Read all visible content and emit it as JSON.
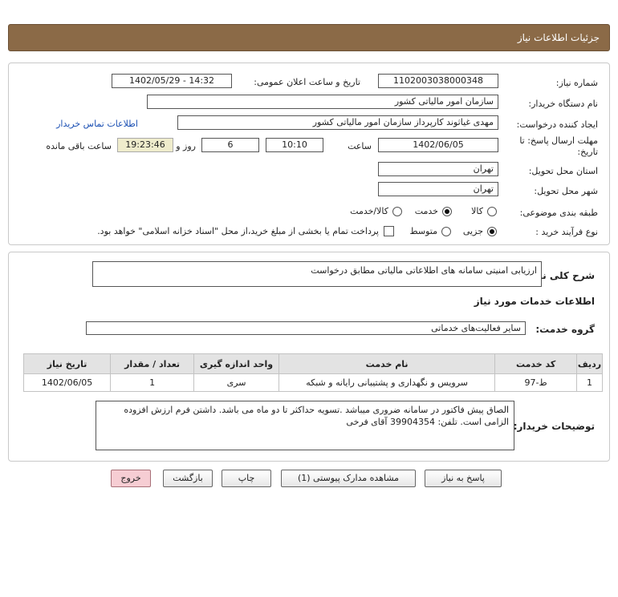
{
  "header": {
    "title": "جزئیات اطلاعات نیاز"
  },
  "form": {
    "need_number_label": "شماره نیاز:",
    "need_number": "1102003038000348",
    "announce_label": "تاریخ و ساعت اعلان عمومی:",
    "announce_value": "1402/05/29 - 14:32",
    "buyer_org_label": "نام دستگاه خریدار:",
    "buyer_org": "سازمان امور مالیاتی کشور",
    "creator_label": "ایجاد کننده درخواست:",
    "creator": "مهدی غیاثوند کارپرداز سازمان امور مالیاتی کشور",
    "contact_link": "اطلاعات تماس خریدار",
    "deadline_label_1": "مهلت ارسال پاسخ: تا",
    "deadline_label_2": "تاریخ:",
    "deadline_date": "1402/06/05",
    "time_label": "ساعت",
    "deadline_time": "10:10",
    "days_value": "6",
    "days_label": "روز و",
    "remaining_time": "19:23:46",
    "remaining_label": "ساعت باقی مانده",
    "province_label": "استان محل تحویل:",
    "province": "تهران",
    "city_label": "شهر محل تحویل:",
    "city": "تهران",
    "category_label": "طبقه بندی موضوعی:",
    "category_options": [
      "کالا",
      "خدمت",
      "کالا/خدمت"
    ],
    "category_selected": "خدمت",
    "purchase_type_label": "نوع فرآیند خرید :",
    "purchase_options": [
      "جزیی",
      "متوسط"
    ],
    "purchase_selected": "جزیی",
    "payment_note": "پرداخت تمام یا بخشی از مبلغ خرید،از محل \"اسناد خزانه اسلامی\" خواهد بود."
  },
  "details": {
    "summary_label": "شرح کلی نیاز:",
    "summary": "ارزیابی امنیتی سامانه های اطلاعاتی مالیاتی مطابق درخواست",
    "services_heading": "اطلاعات خدمات مورد نیاز",
    "service_group_label": "گروه خدمت:",
    "service_group": "سایر فعالیت‌های خدماتی",
    "table": {
      "headers": [
        "ردیف",
        "کد خدمت",
        "نام خدمت",
        "واحد اندازه گیری",
        "تعداد / مقدار",
        "تاریخ نیاز"
      ],
      "rows": [
        [
          "1",
          "ط-97",
          "سرویس و نگهداری و پشتیبانی رایانه و شبکه",
          "سری",
          "1",
          "1402/06/05"
        ]
      ]
    },
    "buyer_notes_label": "توضیحات خریدار:",
    "buyer_notes": "الصاق پیش فاکتور در سامانه ضروری میباشد .تسویه حداکثر تا دو ماه می باشد.  داشتن فرم ارزش افزوده الزامی است. تلفن:  39904354 آقای فرخی"
  },
  "buttons": {
    "reply": "پاسخ به نیاز",
    "attachments": "مشاهده مدارک پیوستی (1)",
    "print": "چاپ",
    "back": "بازگشت",
    "exit": "خروج"
  },
  "colors": {
    "header_bg": "#8b6a47",
    "link": "#1a4fb3",
    "time_highlight": "#efeccc",
    "exit_button": "#f6cdd3"
  }
}
